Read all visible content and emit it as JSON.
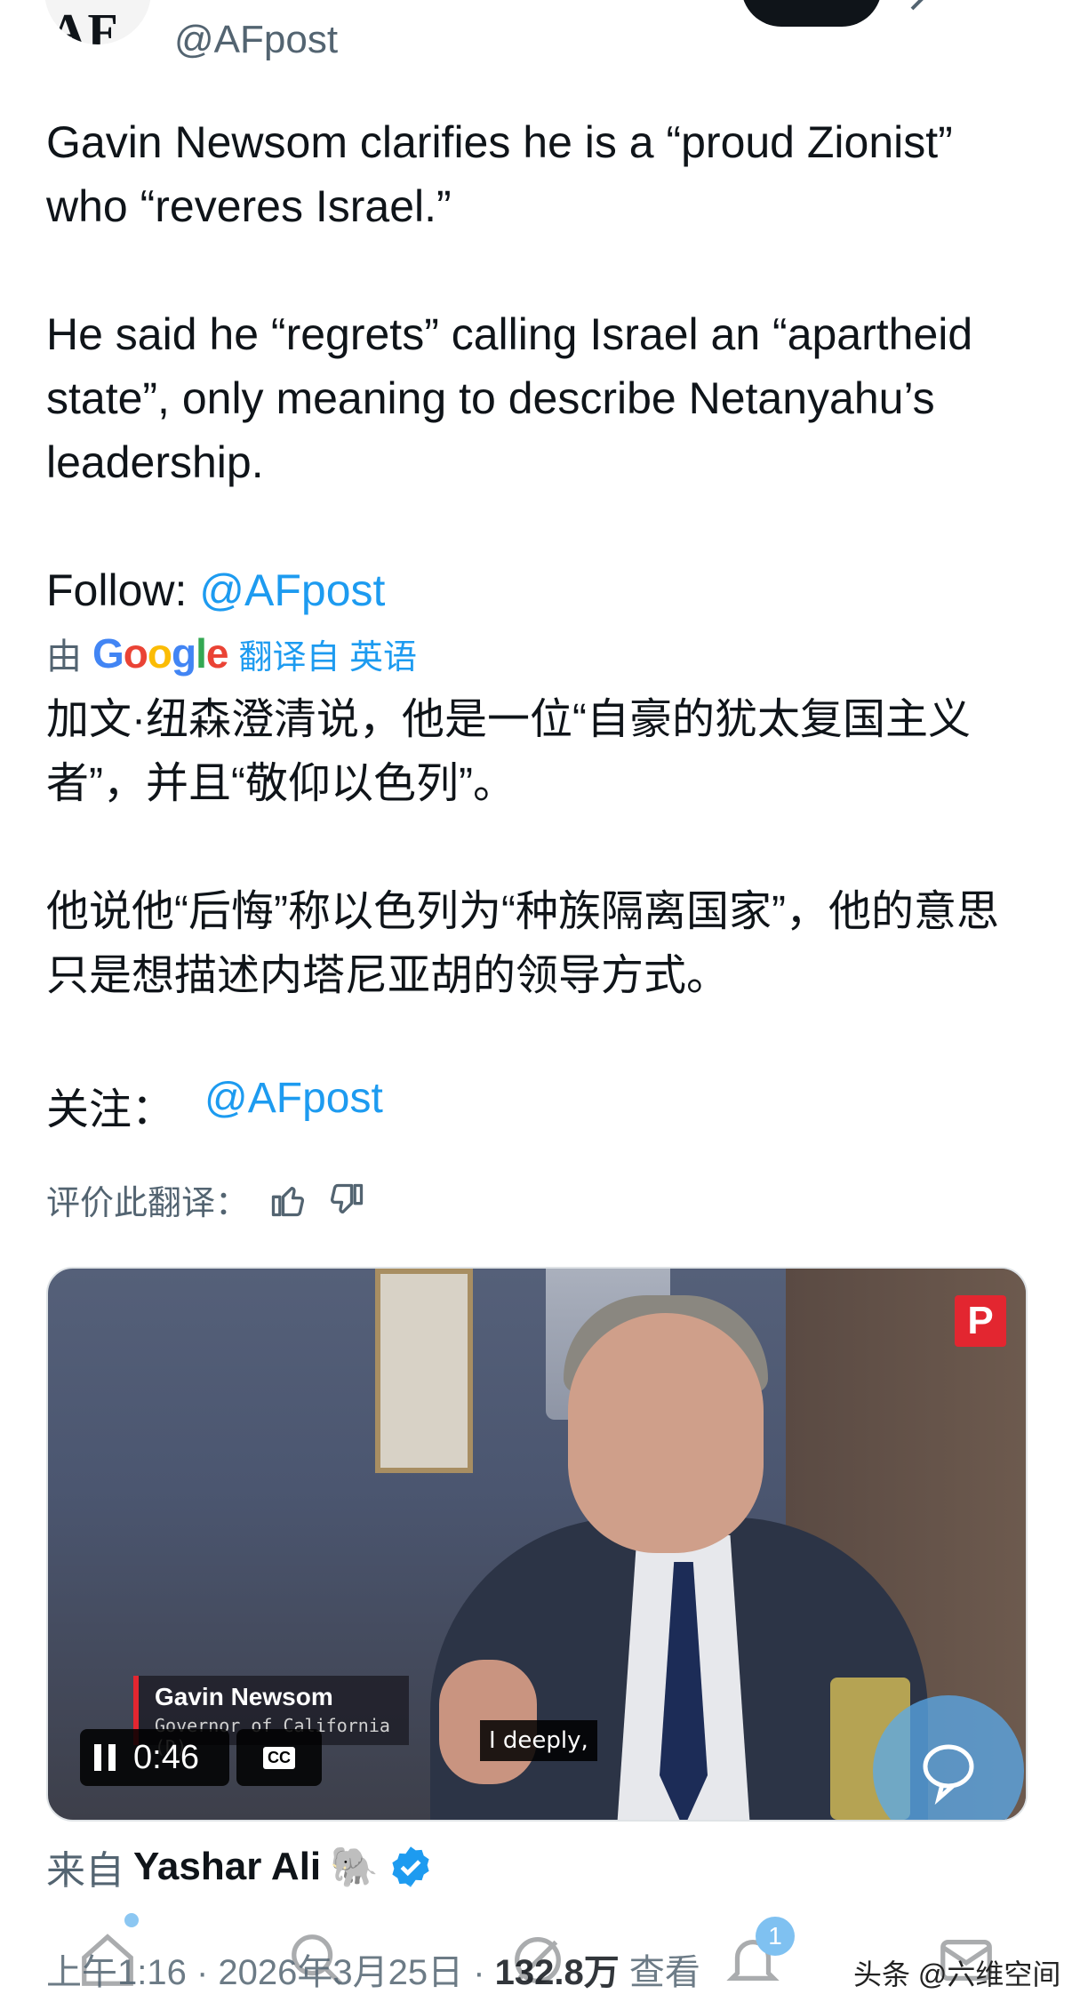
{
  "header": {
    "avatar_logo": "AF.",
    "handle": "@AFpost"
  },
  "tweet": {
    "text_en": "Gavin Newsom clarifies he is a “proud Zionist” who “reveres Israel.”\n\nHe said he “regrets” calling Israel an “apartheid state”, only meaning to describe Netanyahu’s leadership.\n\nFollow: ",
    "mention_en": "@AFpost"
  },
  "translation": {
    "by": "由",
    "provider": "Google",
    "link": "翻译自 英语",
    "text_zh": "加文·纽森澄清说，他是一位“自豪的犹太复国主义者”，并且“敬仰以色列”。\n\n他说他“后悔”称以色列为“种族隔离国家”，他的意思只是想描述内塔尼亚胡的领导方式。",
    "follow_label": "关注：",
    "follow_mention": "@AFpost",
    "rate_label": "评价此翻译："
  },
  "video": {
    "channel_badge": "P",
    "lower_third_name": "Gavin Newsom",
    "lower_third_title": "Governor of California (D)",
    "time": "0:46",
    "cc_label": "CC",
    "subtitle": "I deeply,"
  },
  "source": {
    "prefix": "来自",
    "name": "Yashar Ali",
    "emoji": "🐘"
  },
  "meta": {
    "time": "上午1:16 · 2026年3月25日 · ",
    "views": "132.8万",
    "views_label": " 查看"
  },
  "nav": {
    "notifications_count": "1"
  },
  "watermark": "头条 @六维空间",
  "colors": {
    "link": "#1d9bf0",
    "text": "#0f1419",
    "muted": "#536471",
    "verified": "#1d9bf0"
  }
}
